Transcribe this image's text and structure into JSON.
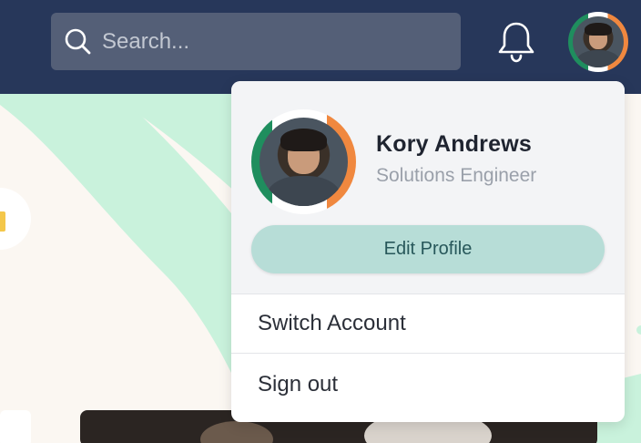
{
  "search": {
    "placeholder": "Search...",
    "icon": "search-icon"
  },
  "header": {
    "notifications_icon": "bell-icon",
    "avatar_icon": "user-avatar"
  },
  "profile_menu": {
    "name": "Kory Andrews",
    "role": "Solutions Engineer",
    "edit_label": "Edit Profile",
    "items": [
      {
        "label": "Switch Account"
      },
      {
        "label": "Sign out"
      }
    ]
  },
  "colors": {
    "topbar": "#27375a",
    "search_bg": "#545f77",
    "edit_button": "#b7ddd7",
    "accent_green": "#1f8e5e",
    "accent_orange": "#f0883f",
    "background_wave": "#c9f2dc"
  }
}
